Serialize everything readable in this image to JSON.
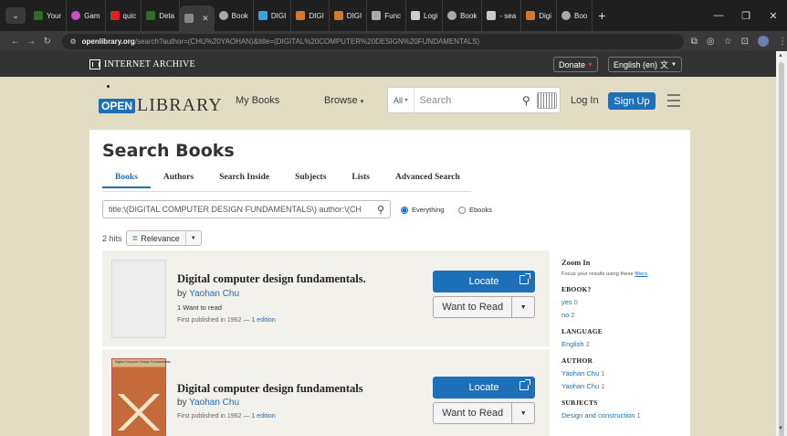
{
  "browser": {
    "tabs": [
      {
        "label": "Your",
        "color": "#2a6e2a"
      },
      {
        "label": "Gam",
        "color": "#c94cc9"
      },
      {
        "label": "quic",
        "color": "#d22"
      },
      {
        "label": "Deta",
        "color": "#2a6e2a"
      },
      {
        "label": "",
        "color": "#888",
        "active": true
      },
      {
        "label": "Book",
        "color": "#aaa"
      },
      {
        "label": "DIGI",
        "color": "#3aa0e0"
      },
      {
        "label": "DIGI",
        "color": "#d07a2a"
      },
      {
        "label": "DIGI",
        "color": "#d07a2a"
      },
      {
        "label": "Func",
        "color": "#aaa"
      },
      {
        "label": "Logi",
        "color": "#ccc"
      },
      {
        "label": "Book",
        "color": "#aaa"
      },
      {
        "label": "- sea",
        "color": "#ccc"
      },
      {
        "label": "Digi",
        "color": "#d07a2a"
      },
      {
        "label": "Boo",
        "color": "#aaa"
      }
    ],
    "new_tab": "+",
    "url_host": "openlibrary.org",
    "url_path": "/search?author=(CHU%20YAOHAN)&title=(DIGITAL%20COMPUTER%20DESIGN%20FUNDAMENTALS)"
  },
  "ia_bar": {
    "logo_text": "INTERNET ARCHIVE",
    "donate": "Donate",
    "language": "English (en)"
  },
  "header": {
    "logo_open": "OPEN",
    "logo_library": "LIBRARY",
    "my_books": "My Books",
    "browse": "Browse",
    "search_scope": "All",
    "search_placeholder": "Search",
    "login": "Log In",
    "signup": "Sign Up"
  },
  "main": {
    "title": "Search Books",
    "tabs": [
      "Books",
      "Authors",
      "Search Inside",
      "Subjects",
      "Lists",
      "Advanced Search"
    ],
    "query": "title:\\(DIGITAL COMPUTER DESIGN FUNDAMENTALS\\) author:\\(CH",
    "radio_everything": "Everything",
    "radio_ebooks": "Ebooks",
    "hits": "2 hits",
    "sort": "Relevance"
  },
  "results": [
    {
      "title": "Digital computer design fundamentals.",
      "by": "by",
      "author": "Yaohan Chu",
      "want": "1 Want to read",
      "pub_prefix": "First published in 1962 —",
      "edition": "1 edition",
      "locate": "Locate",
      "want_button": "Want to Read"
    },
    {
      "title": "Digital computer design fundamentals",
      "by": "by",
      "author": "Yaohan Chu",
      "want": "",
      "pub_prefix": "First published in 1962 —",
      "edition": "1 edition",
      "locate": "Locate",
      "want_button": "Want to Read",
      "cover_text": "Digital Computer Design Fundamentals"
    }
  ],
  "facets": {
    "zoom_title": "Zoom In",
    "zoom_hint": "Focus your results using these",
    "zoom_link": "filters",
    "groups": [
      {
        "title": "EBOOK?",
        "items": [
          {
            "label": "yes",
            "count": "0"
          },
          {
            "label": "no",
            "count": "2"
          }
        ]
      },
      {
        "title": "LANGUAGE",
        "items": [
          {
            "label": "English",
            "count": "2"
          }
        ]
      },
      {
        "title": "AUTHOR",
        "items": [
          {
            "label": "Yaohan Chu",
            "count": "1"
          },
          {
            "label": "Yaohan Chu",
            "count": "1"
          }
        ]
      },
      {
        "title": "SUBJECTS",
        "items": [
          {
            "label": "Design and construction",
            "count": "1"
          }
        ]
      }
    ]
  }
}
